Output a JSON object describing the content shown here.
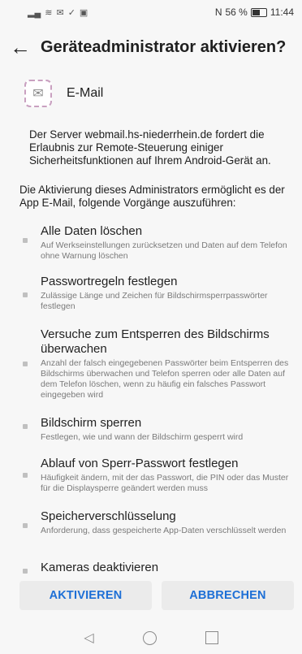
{
  "status": {
    "left_icons": [
      "signal-icon",
      "wifi-icon",
      "mail-icon",
      "check-icon",
      "image-icon"
    ],
    "nfc": "N",
    "battery_percent": "56 %",
    "time": "11:44"
  },
  "header": {
    "back_icon": "arrow-left-icon",
    "title": "Geräteadministrator aktivieren?"
  },
  "app": {
    "name": "E-Mail",
    "icon": "email-app-icon"
  },
  "description": "Der Server webmail.hs-niederrhein.de fordert die Erlaubnis zur Remote-Steuerung einiger Sicherheitsfunktionen auf Ihrem Android-Gerät an.",
  "intro": "Die Aktivierung dieses Administrators ermöglicht es der App E-Mail, folgende Vorgänge auszuführen:",
  "permissions": [
    {
      "title": "Alle Daten löschen",
      "desc": "Auf Werkseinstellungen zurücksetzen und Daten auf dem Telefon ohne Warnung löschen"
    },
    {
      "title": "Passwortregeln festlegen",
      "desc": "Zulässige Länge und Zeichen für Bildschirmsperrpasswörter festlegen"
    },
    {
      "title": "Versuche zum Entsperren des Bildschirms überwachen",
      "desc": "Anzahl der falsch eingegebenen Passwörter beim Entsperren des Bildschirms überwachen und Telefon sperren oder alle Daten auf dem Telefon löschen, wenn zu häufig ein falsches Passwort eingegeben wird"
    },
    {
      "title": "Bildschirm sperren",
      "desc": "Festlegen, wie und wann der Bildschirm gesperrt wird"
    },
    {
      "title": "Ablauf von Sperr-Passwort festlegen",
      "desc": "Häufigkeit ändern, mit der das Passwort, die PIN oder das Muster für die Displaysperre geändert werden muss"
    },
    {
      "title": "Speicherverschlüsselung",
      "desc": "Anforderung, dass gespeicherte App-Daten verschlüsselt werden"
    },
    {
      "title": "Kameras deaktivieren",
      "desc": ""
    }
  ],
  "actions": {
    "activate": "AKTIVIEREN",
    "cancel": "ABBRECHEN"
  },
  "nav": {
    "back_icon": "nav-back-icon",
    "home_icon": "nav-home-icon",
    "recent_icon": "nav-recent-icon"
  }
}
